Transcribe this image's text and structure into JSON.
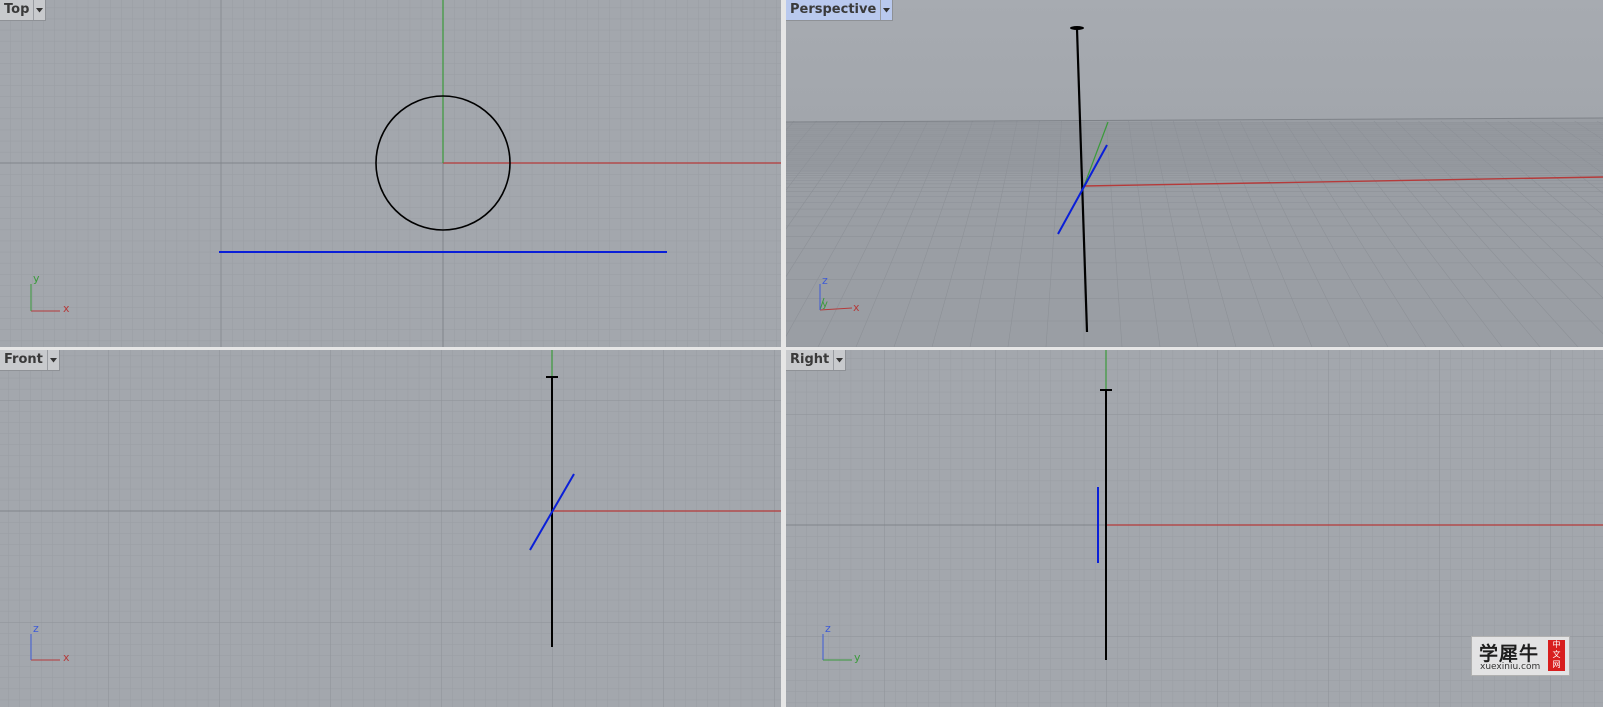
{
  "viewports": {
    "top": {
      "title": "Top",
      "axis_labels": {
        "h": "x",
        "v": "y"
      }
    },
    "perspective": {
      "title": "Perspective",
      "axis_labels": {
        "h": "x",
        "v": "y",
        "z": "z"
      }
    },
    "front": {
      "title": "Front",
      "axis_labels": {
        "h": "x",
        "v": "z"
      }
    },
    "right": {
      "title": "Right",
      "axis_labels": {
        "h": "y",
        "v": "z"
      }
    }
  },
  "colors": {
    "viewport_bg": "#a3a7ad",
    "grid_minor": "#989ca2",
    "grid_major": "#8c9096",
    "x_axis": "#b53a3a",
    "y_axis": "#3a9a3a",
    "z_axis": "#3d5bd6",
    "curve_blue": "#0a1fd8",
    "curve_black": "#000000"
  },
  "icons": {
    "viewport_menu": "triangle-down-icon"
  },
  "watermark": {
    "chinese": "学犀牛",
    "domain": "xuexiniu.com",
    "tag_1": "中",
    "tag_2": "文",
    "tag_3": "网"
  }
}
